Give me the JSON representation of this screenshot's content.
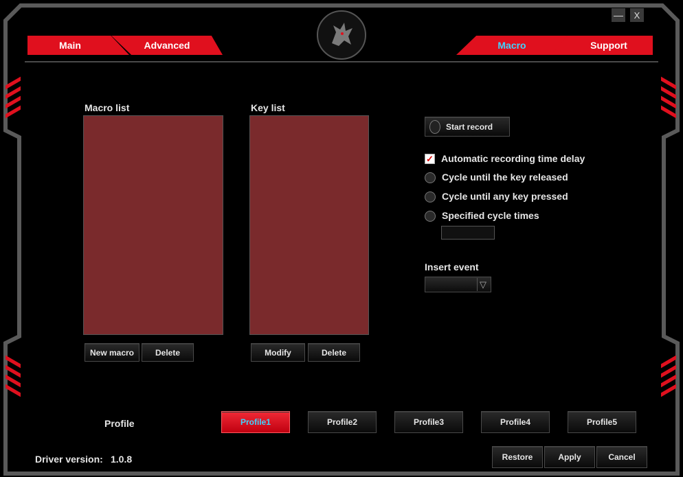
{
  "window": {
    "minimize_label": "—",
    "close_label": "X"
  },
  "tabs": [
    {
      "label": "Main"
    },
    {
      "label": "Advanced"
    },
    {
      "label": "Macro"
    },
    {
      "label": "Support"
    }
  ],
  "macro": {
    "macro_list_label": "Macro list",
    "key_list_label": "Key list",
    "new_macro_label": "New macro",
    "delete_macro_label": "Delete",
    "modify_label": "Modify",
    "delete_key_label": "Delete",
    "start_record_label": "Start record",
    "options": [
      {
        "label": "Automatic recording time delay",
        "type": "checkbox",
        "checked": true
      },
      {
        "label": "Cycle until the key released",
        "type": "radio"
      },
      {
        "label": "Cycle until any key pressed",
        "type": "radio"
      },
      {
        "label": "Specified cycle times",
        "type": "radio"
      }
    ],
    "cycle_times_value": "",
    "insert_event_label": "Insert event",
    "insert_event_value": "",
    "check_mark": "✓",
    "dropdown_arrow": "▽"
  },
  "profile": {
    "label": "Profile",
    "buttons": [
      "Profile1",
      "Profile2",
      "Profile3",
      "Profile4",
      "Profile5"
    ],
    "active": "Profile1"
  },
  "footer": {
    "driver_version_label": "Driver version:",
    "driver_version": "1.0.8",
    "restore_label": "Restore",
    "apply_label": "Apply",
    "cancel_label": "Cancel"
  },
  "colors": {
    "accent": "#e0101e",
    "active_text": "#3fd3ff",
    "list_bg": "#7a2a2c"
  },
  "icons": {
    "logo": "dragon-logo-icon"
  }
}
